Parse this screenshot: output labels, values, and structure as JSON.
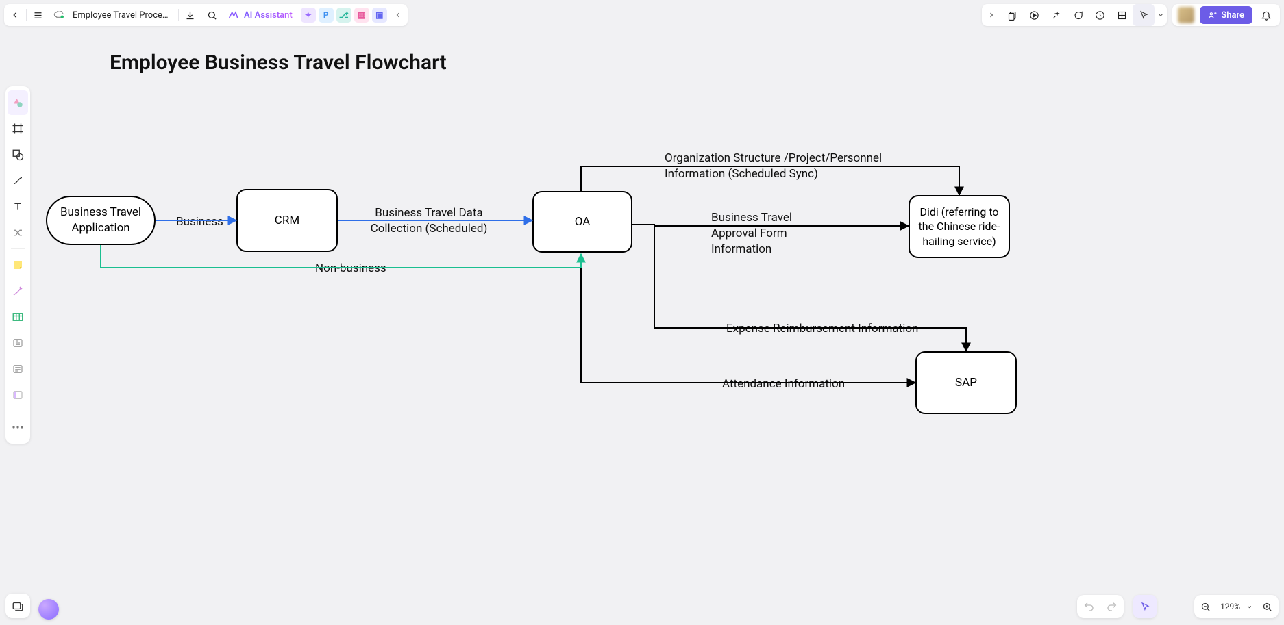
{
  "doc_title": "Employee Travel Process...",
  "ai_label": "AI Assistant",
  "share_label": "Share",
  "zoom_label": "129%",
  "diagram_title": "Employee Business Travel Flowchart",
  "nodes": {
    "start": "Business Travel Application",
    "crm": "CRM",
    "oa": "OA",
    "didi": "Didi (referring to the Chinese ride-hailing service)",
    "sap": "SAP"
  },
  "edges": {
    "business": "Business",
    "collect": "Business Travel Data Collection (Scheduled)",
    "nonbusiness": "Non-business",
    "org": "Organization Structure /Project/Personnel Information (Scheduled Sync)",
    "approval": "Business Travel Approval Form Information",
    "expense": "Expense Reimbursement Information",
    "attendance": "Attendance Information"
  }
}
